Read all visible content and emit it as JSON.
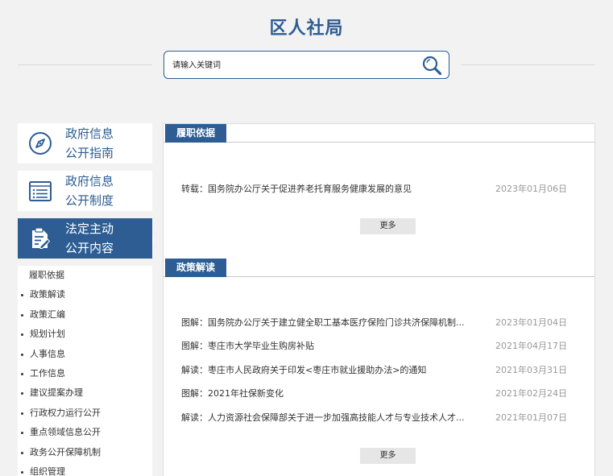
{
  "header": {
    "title": "区人社局"
  },
  "search": {
    "placeholder": "请输入关键词"
  },
  "sidebar": {
    "cards": [
      {
        "line1": "政府信息",
        "line2": "公开指南",
        "icon": "compass-icon",
        "active": false
      },
      {
        "line1": "政府信息",
        "line2": "公开制度",
        "icon": "list-document-icon",
        "active": false
      },
      {
        "line1": "法定主动",
        "line2": "公开内容",
        "icon": "edit-document-icon",
        "active": true
      }
    ],
    "submenu": [
      "履职依据",
      "政策解读",
      "政策汇编",
      "规划计划",
      "人事信息",
      "工作信息",
      "建议提案办理",
      "行政权力运行公开",
      "重点领域信息公开",
      "政务公开保障机制",
      "组织管理"
    ]
  },
  "sections": [
    {
      "tab": "履职依据",
      "items": [
        {
          "title": "转载：国务院办公厅关于促进养老托育服务健康发展的意见",
          "date": "2023年01月06日"
        }
      ],
      "more": "更多"
    },
    {
      "tab": "政策解读",
      "items": [
        {
          "title": "图解：国务院办公厅关于建立健全职工基本医疗保险门诊共济保障机制...",
          "date": "2023年01月04日"
        },
        {
          "title": "图解：枣庄市大学毕业生购房补贴",
          "date": "2021年04月17日"
        },
        {
          "title": "解读：枣庄市人民政府关于印发<枣庄市就业援助办法>的通知",
          "date": "2021年03月31日"
        },
        {
          "title": "图解：2021年社保新变化",
          "date": "2021年02月24日"
        },
        {
          "title": "解读：人力资源社会保障部关于进一步加强高技能人才与专业技术人才...",
          "date": "2021年01月07日"
        }
      ],
      "more": "更多"
    }
  ],
  "colors": {
    "brand": "#2d5d93",
    "background": "#f2f2f2",
    "date": "#999999"
  }
}
